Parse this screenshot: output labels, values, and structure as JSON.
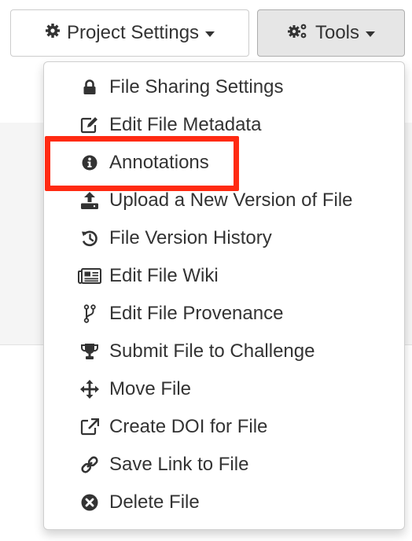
{
  "toolbar": {
    "project_settings_label": "Project Settings",
    "tools_label": "Tools"
  },
  "menu": {
    "items": [
      {
        "label": "File Sharing Settings",
        "icon": "lock-icon"
      },
      {
        "label": "Edit File Metadata",
        "icon": "edit-icon"
      },
      {
        "label": "Annotations",
        "icon": "info-circle-icon"
      },
      {
        "label": "Upload a New Version of File",
        "icon": "upload-icon"
      },
      {
        "label": "File Version History",
        "icon": "history-icon"
      },
      {
        "label": "Edit File Wiki",
        "icon": "newspaper-icon"
      },
      {
        "label": "Edit File Provenance",
        "icon": "code-branch-icon"
      },
      {
        "label": "Submit File to Challenge",
        "icon": "trophy-icon"
      },
      {
        "label": "Move File",
        "icon": "move-arrows-icon"
      },
      {
        "label": "Create DOI for File",
        "icon": "external-link-icon"
      },
      {
        "label": "Save Link to File",
        "icon": "link-icon"
      },
      {
        "label": "Delete File",
        "icon": "times-circle-icon"
      }
    ],
    "highlighted_item": "Annotations"
  },
  "colors": {
    "highlight_border": "#ff2a12",
    "text": "#333333",
    "tools_button_bg": "#e6e6e6"
  }
}
